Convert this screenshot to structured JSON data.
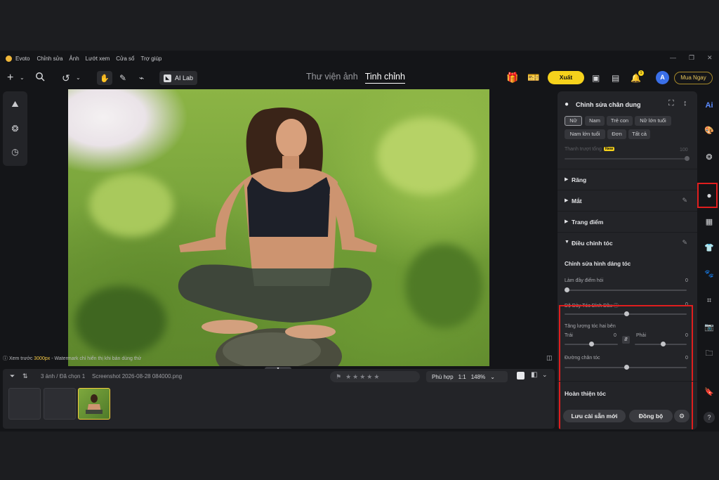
{
  "menubar": {
    "app_name": "Evoto",
    "items": [
      "Chỉnh sửa",
      "Ảnh",
      "Lướt xem",
      "Cửa sổ",
      "Trợ giúp"
    ]
  },
  "toolbar": {
    "ai_lab_label": "AI Lab",
    "tabs": [
      {
        "label": "Thư viện ảnh",
        "active": false
      },
      {
        "label": "Tinh chỉnh",
        "active": true
      }
    ],
    "export_label": "Xuất",
    "avatar_initial": "A",
    "buy_label": "Mua Ngay",
    "notification_count": "1"
  },
  "canvas": {
    "status_prefix": "Xem trước",
    "status_resolution": "3000px",
    "status_suffix": "- Watermark chỉ hiển thị khi bản dùng thử"
  },
  "filmstrip": {
    "count_text": "3 ảnh / Đã chọn 1",
    "filename": "Screenshot 2026-08-28 084000.png",
    "rating_stars": "★★★★★",
    "fit_label": "Phù hợp",
    "ratio_label": "1:1",
    "zoom_label": "148%"
  },
  "right_panel": {
    "title": "Chỉnh sửa chân dung",
    "chips_row1": [
      "Nữ",
      "Nam",
      "Trẻ con",
      "Nữ lớn tuổi"
    ],
    "chips_row2": [
      "Nam lớn tuổi",
      "Đơn",
      "Tất cả"
    ],
    "overall_slider_label": "Thanh trượt tổng",
    "new_badge": "New",
    "overall_slider_value": "100",
    "sections": [
      {
        "label": "Răng",
        "expanded": false
      },
      {
        "label": "Mắt",
        "expanded": false
      },
      {
        "label": "Trang điểm",
        "expanded": false
      },
      {
        "label": "Điều chỉnh tóc",
        "expanded": true
      }
    ],
    "hair_shape_heading": "Chỉnh sửa hình dáng tóc",
    "sliders": [
      {
        "label": "Làm đầy điểm hói",
        "value": "0",
        "level": 0.0
      },
      {
        "label": "Độ Dày Tóc Đỉnh Đầu",
        "value": "0",
        "level": 0.5
      },
      {
        "label": "Đường chân tóc",
        "value": "0",
        "level": 0.5
      }
    ],
    "side_volume_label": "Tăng lượng tóc hai bên",
    "left_label": "Trái",
    "left_value": "0",
    "right_label": "Phải",
    "right_value": "0",
    "finish_heading": "Hoàn thiện tóc",
    "save_preset_label": "Lưu cài sẵn mới",
    "sync_label": "Đồng bộ"
  },
  "rail": {
    "ai_label": "Ai"
  },
  "colors": {
    "accent_yellow": "#f6d21c",
    "highlight_red": "#e01e1e",
    "panel_bg": "#232428",
    "app_bg": "#141518"
  }
}
